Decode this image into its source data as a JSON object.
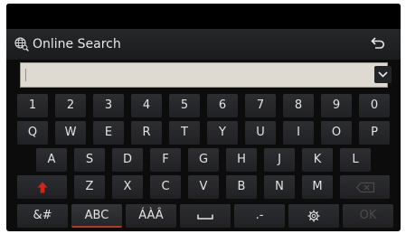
{
  "header": {
    "title": "Online Search",
    "title_icon": "globe-search-icon",
    "back_icon": "back-arrow-icon"
  },
  "search": {
    "value": "",
    "dropdown_icon": "chevron-down-icon"
  },
  "keyboard": {
    "row1": [
      "1",
      "2",
      "3",
      "4",
      "5",
      "6",
      "7",
      "8",
      "9",
      "0"
    ],
    "row2": [
      "Q",
      "W",
      "E",
      "R",
      "T",
      "Y",
      "U",
      "I",
      "O",
      "P"
    ],
    "row3": [
      "A",
      "S",
      "D",
      "F",
      "G",
      "H",
      "J",
      "K",
      "L"
    ],
    "row4": [
      "Z",
      "X",
      "C",
      "V",
      "B",
      "N",
      "M"
    ],
    "shift_icon": "shift-arrow-icon",
    "backspace_icon": "backspace-icon",
    "bottom": {
      "symbols": "&#",
      "abc": "ABC",
      "accents": "ÁÀÂ",
      "space_icon": "space-icon",
      "dash": ".-",
      "settings_icon": "gear-icon",
      "ok": "OK"
    }
  },
  "colors": {
    "background": "#0c0c0d",
    "key": "#2d2e31",
    "accent_red": "#d4251c",
    "input_bg": "#dedad2"
  }
}
